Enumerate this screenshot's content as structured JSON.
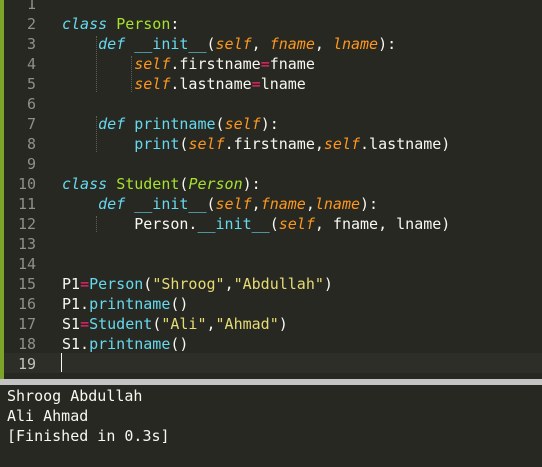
{
  "editor": {
    "lines": [
      {
        "n": "1",
        "tokens": []
      },
      {
        "n": "2",
        "tokens": [
          [
            "kw-i",
            "class"
          ],
          [
            "p",
            " "
          ],
          [
            "cls",
            "Person"
          ],
          [
            "p",
            ":"
          ]
        ]
      },
      {
        "n": "3",
        "tokens": [
          [
            "p",
            "    "
          ],
          [
            "kw-i",
            "def"
          ],
          [
            "p",
            " "
          ],
          [
            "fn",
            "__init__"
          ],
          [
            "p",
            "("
          ],
          [
            "arg",
            "self"
          ],
          [
            "p",
            ", "
          ],
          [
            "arg",
            "fname"
          ],
          [
            "p",
            ", "
          ],
          [
            "arg",
            "lname"
          ],
          [
            "p",
            "):"
          ]
        ]
      },
      {
        "n": "4",
        "tokens": [
          [
            "p",
            "        "
          ],
          [
            "self",
            "self"
          ],
          [
            "p",
            ".firstname"
          ],
          [
            "op",
            "="
          ],
          [
            "p",
            "fname"
          ]
        ]
      },
      {
        "n": "5",
        "tokens": [
          [
            "p",
            "        "
          ],
          [
            "self",
            "self"
          ],
          [
            "p",
            ".lastname"
          ],
          [
            "op",
            "="
          ],
          [
            "p",
            "lname"
          ]
        ]
      },
      {
        "n": "6",
        "tokens": []
      },
      {
        "n": "7",
        "tokens": [
          [
            "p",
            "    "
          ],
          [
            "kw-i",
            "def"
          ],
          [
            "p",
            " "
          ],
          [
            "fn",
            "printname"
          ],
          [
            "p",
            "("
          ],
          [
            "arg",
            "self"
          ],
          [
            "p",
            "):"
          ]
        ]
      },
      {
        "n": "8",
        "tokens": [
          [
            "p",
            "        "
          ],
          [
            "builtin",
            "print"
          ],
          [
            "p",
            "("
          ],
          [
            "self",
            "self"
          ],
          [
            "p",
            ".firstname,"
          ],
          [
            "self",
            "self"
          ],
          [
            "p",
            ".lastname)"
          ]
        ]
      },
      {
        "n": "9",
        "tokens": []
      },
      {
        "n": "10",
        "tokens": [
          [
            "kw-i",
            "class"
          ],
          [
            "p",
            " "
          ],
          [
            "cls",
            "Student"
          ],
          [
            "p",
            "("
          ],
          [
            "inh",
            "Person"
          ],
          [
            "p",
            "):"
          ]
        ]
      },
      {
        "n": "11",
        "tokens": [
          [
            "p",
            "    "
          ],
          [
            "kw-i",
            "def"
          ],
          [
            "p",
            " "
          ],
          [
            "fn",
            "__init__"
          ],
          [
            "p",
            "("
          ],
          [
            "arg",
            "self"
          ],
          [
            "p",
            ","
          ],
          [
            "arg",
            "fname"
          ],
          [
            "p",
            ","
          ],
          [
            "arg",
            "lname"
          ],
          [
            "p",
            "):"
          ]
        ]
      },
      {
        "n": "12",
        "tokens": [
          [
            "p",
            "        Person."
          ],
          [
            "fn",
            "__init__"
          ],
          [
            "p",
            "("
          ],
          [
            "self",
            "self"
          ],
          [
            "p",
            ", fname, lname)"
          ]
        ]
      },
      {
        "n": "13",
        "tokens": []
      },
      {
        "n": "14",
        "tokens": []
      },
      {
        "n": "15",
        "tokens": [
          [
            "p",
            "P1"
          ],
          [
            "op",
            "="
          ],
          [
            "builtin",
            "Person"
          ],
          [
            "p",
            "("
          ],
          [
            "str",
            "\"Shroog\""
          ],
          [
            "p",
            ","
          ],
          [
            "str",
            "\"Abdullah\""
          ],
          [
            "p",
            ")"
          ]
        ]
      },
      {
        "n": "16",
        "tokens": [
          [
            "p",
            "P1."
          ],
          [
            "builtin",
            "printname"
          ],
          [
            "p",
            "()"
          ]
        ]
      },
      {
        "n": "17",
        "tokens": [
          [
            "p",
            "S1"
          ],
          [
            "op",
            "="
          ],
          [
            "builtin",
            "Student"
          ],
          [
            "p",
            "("
          ],
          [
            "str",
            "\"Ali\""
          ],
          [
            "p",
            ","
          ],
          [
            "str",
            "\"Ahmad\""
          ],
          [
            "p",
            ")"
          ]
        ]
      },
      {
        "n": "18",
        "tokens": [
          [
            "p",
            "S1."
          ],
          [
            "builtin",
            "printname"
          ],
          [
            "p",
            "()"
          ]
        ]
      },
      {
        "n": "19",
        "tokens": []
      }
    ],
    "current_line": "19"
  },
  "colors": {
    "kw-i": "#66d9ef",
    "cls": "#a6e22e",
    "fn": "#66d9ef",
    "arg": "#fd971f",
    "self": "#fd971f",
    "op": "#f92672",
    "str": "#e6db74",
    "builtin": "#66d9ef",
    "inh": "#a6e22e",
    "p": "#f8f8f2"
  },
  "output": {
    "lines": [
      "Shroog Abdullah",
      "Ali Ahmad",
      "[Finished in 0.3s]"
    ]
  }
}
